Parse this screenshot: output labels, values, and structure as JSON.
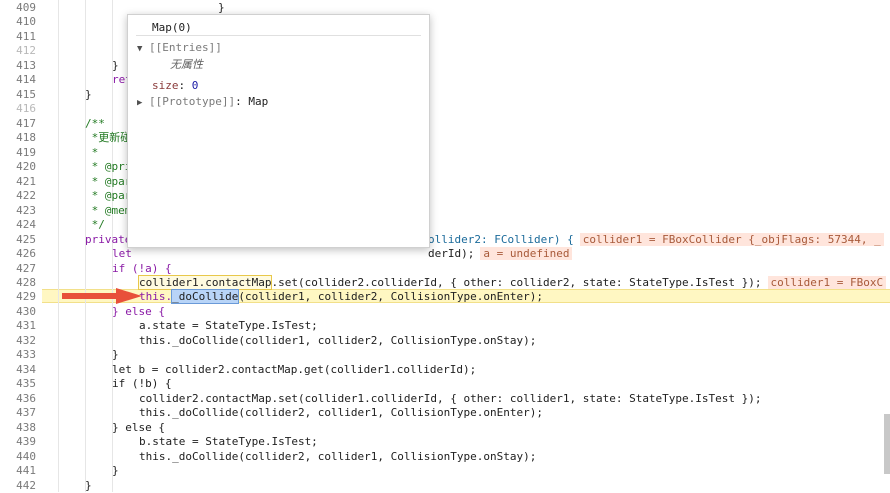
{
  "gutter": {
    "lines": [
      "409",
      "410",
      "411",
      "412",
      "413",
      "414",
      "415",
      "416",
      "417",
      "418",
      "419",
      "420",
      "421",
      "422",
      "423",
      "424",
      "425",
      "426",
      "427",
      "428",
      "429",
      "430",
      "431",
      "432",
      "433",
      "434",
      "435",
      "436",
      "437",
      "438",
      "439",
      "440",
      "441",
      "442"
    ]
  },
  "code": {
    "l409": "}",
    "l413": "}",
    "l414": "ret",
    "l415": "}",
    "l417": "/**",
    "l418": " *更新碰",
    "l419": " *",
    "l420": " * @pri",
    "l421": " * @par",
    "l422": " * @par",
    "l423": " * @mem",
    "l424": " */",
    "l425_a": "private",
    "l425_b": "ollider2: FCollider) {",
    "l425_val": "collider1 = FBoxCollider {_objFlags: 57344, _",
    "l426_a": "let",
    "l426_b": "derId);",
    "l426_val": "a = undefined",
    "l427": "if (!a) {",
    "l428_a": "collider1.contactMap",
    "l428_b": ".set(collider2.colliderId, { other: collider2, state: StateType.IsTest });",
    "l428_val": "collider1 = FBoxC",
    "l429_a": "this.",
    "l429_sel": "_doCollide",
    "l429_b": "(collider1, collider2, CollisionType.onEnter);",
    "l430": "} else {",
    "l431": "a.state = StateType.IsTest;",
    "l432": "this._doCollide(collider1, collider2, CollisionType.onStay);",
    "l433": "}",
    "l434": "let b = collider2.contactMap.get(collider1.colliderId);",
    "l435": "if (!b) {",
    "l436": "collider2.contactMap.set(collider1.colliderId, { other: collider1, state: StateType.IsTest });",
    "l437": "this._doCollide(collider2, collider1, CollisionType.onEnter);",
    "l438": "} else {",
    "l439": "b.state = StateType.IsTest;",
    "l440": "this._doCollide(collider2, collider1, CollisionType.onStay);",
    "l441": "}",
    "l442": "}"
  },
  "popup": {
    "title": "Map(0)",
    "entries_label": "[[Entries]]",
    "empty_label": "无属性",
    "size_key": "size",
    "size_value": "0",
    "prototype_label": "[[Prototype]]",
    "prototype_value": "Map"
  },
  "colors": {
    "exec_line": "#fff7c2",
    "inline_value_bg": "#ffe5dc",
    "arrow": "#e8503a",
    "selection": "#b8d4f7"
  }
}
